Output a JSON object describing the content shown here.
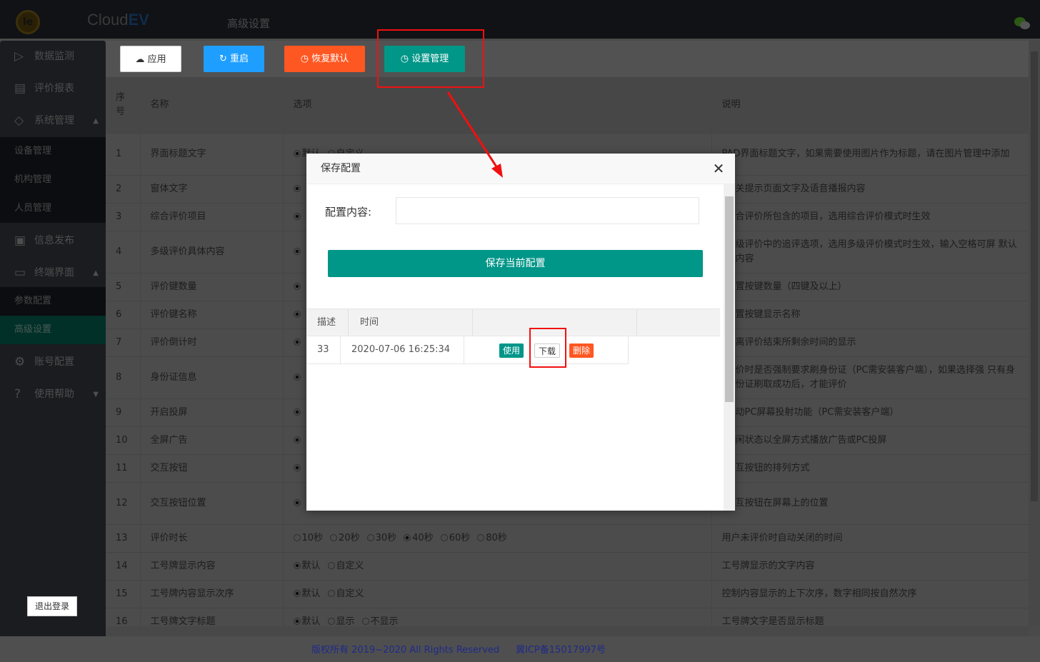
{
  "header": {
    "logo_text": "le",
    "brand_a": "Cloud",
    "brand_b": "EV",
    "page_title": "高级设置"
  },
  "sidebar": {
    "items": [
      {
        "label": "数据监测",
        "icon": "video-icon"
      },
      {
        "label": "评价报表",
        "icon": "clipboard-icon"
      },
      {
        "label": "系统管理",
        "icon": "diamond-icon"
      },
      {
        "label": "信息发布",
        "icon": "image-icon"
      },
      {
        "label": "终端界面",
        "icon": "window-icon"
      },
      {
        "label": "账号配置",
        "icon": "gear-icon"
      },
      {
        "label": "使用帮助",
        "icon": "help-icon"
      }
    ],
    "sub_system": [
      "设备管理",
      "机构管理",
      "人员管理"
    ],
    "sub_terminal": [
      "参数配置",
      "高级设置"
    ],
    "logout": "退出登录"
  },
  "toolbar": {
    "apply": "应用",
    "restart": "重启",
    "restore": "恢复默认",
    "manage": "设置管理"
  },
  "table": {
    "headers": [
      "序号",
      "名称",
      "选项",
      "说明"
    ],
    "rows": [
      {
        "no": "1",
        "name": "界面标题文字",
        "opts": [
          {
            "t": "默认",
            "on": true
          },
          {
            "t": "自定义",
            "on": false
          }
        ],
        "desc": "PAD界面标题文字，如果需要使用图片作为标题，请在图片管理中添加",
        "full": true
      },
      {
        "no": "2",
        "name": "窗体文字",
        "opts": [
          {
            "t": "",
            "on": true
          }
        ],
        "desc": "关提示页面文字及语音播报内容"
      },
      {
        "no": "3",
        "name": "综合评价项目",
        "opts": [
          {
            "t": "",
            "on": true
          }
        ],
        "desc": "合评价所包含的项目，选用综合评价模式时生效"
      },
      {
        "no": "4",
        "name": "多级评价具体内容",
        "opts": [
          {
            "t": "",
            "on": true
          }
        ],
        "desc": "级评价中的追评选项，选用多级评价模式时生效，输入空格可屏 默认内容"
      },
      {
        "no": "5",
        "name": "评价键数量",
        "opts": [
          {
            "t": "",
            "on": true
          }
        ],
        "desc": "置按键数量（四键及以上）"
      },
      {
        "no": "6",
        "name": "评价键名称",
        "opts": [
          {
            "t": "",
            "on": true
          }
        ],
        "desc": "置按键显示名称"
      },
      {
        "no": "7",
        "name": "评价倒计时",
        "opts": [
          {
            "t": "",
            "on": true
          }
        ],
        "desc": "离评价结束所剩余时间的显示"
      },
      {
        "no": "8",
        "name": "身份证信息",
        "opts": [
          {
            "t": "",
            "on": true
          }
        ],
        "desc": "价时是否强制要求刷身份证（PC需安装客户端），如果选择强 只有身份证刷取成功后，才能评价"
      },
      {
        "no": "9",
        "name": "开启投屏",
        "opts": [
          {
            "t": "",
            "on": true
          }
        ],
        "desc": "动PC屏幕投射功能（PC需安装客户端）"
      },
      {
        "no": "10",
        "name": "全屏广告",
        "opts": [
          {
            "t": "",
            "on": true
          }
        ],
        "desc": "闲状态以全屏方式播放广告或PC投屏"
      },
      {
        "no": "11",
        "name": "交互按钮",
        "opts": [
          {
            "t": "",
            "on": true
          }
        ],
        "desc": "互按钮的排列方式"
      },
      {
        "no": "12",
        "name": "交互按钮位置",
        "opts": [
          {
            "t": "",
            "on": true
          }
        ],
        "desc": "互按钮在屏幕上的位置"
      },
      {
        "no": "13",
        "name": "评价时长",
        "opts": [
          {
            "t": "10秒",
            "on": false
          },
          {
            "t": "20秒",
            "on": false
          },
          {
            "t": "30秒",
            "on": false
          },
          {
            "t": "40秒",
            "on": true
          },
          {
            "t": "60秒",
            "on": false
          },
          {
            "t": "80秒",
            "on": false
          }
        ],
        "desc": "用户未评价时自动关闭的时间",
        "full": true
      },
      {
        "no": "14",
        "name": "工号牌显示内容",
        "opts": [
          {
            "t": "默认",
            "on": true
          },
          {
            "t": "自定义",
            "on": false
          }
        ],
        "desc": "工号牌显示的文字内容",
        "full": true
      },
      {
        "no": "15",
        "name": "工号牌内容显示次序",
        "opts": [
          {
            "t": "默认",
            "on": true
          },
          {
            "t": "自定义",
            "on": false
          }
        ],
        "desc": "控制内容显示的上下次序，数字相同按自然次序",
        "full": true
      },
      {
        "no": "16",
        "name": "工号牌文字标题",
        "opts": [
          {
            "t": "默认",
            "on": true
          },
          {
            "t": "显示",
            "on": false
          },
          {
            "t": "不显示",
            "on": false
          }
        ],
        "desc": "工号牌文字是否显示标题",
        "full": true
      }
    ]
  },
  "footer": {
    "copyright": "版权所有 2019~2020 All Rights Reserved",
    "icp": "冀ICP备15017997号"
  },
  "modal": {
    "title": "保存配置",
    "label": "配置内容:",
    "input_value": "",
    "save_button": "保存当前配置",
    "headers": [
      "描述",
      "时间"
    ],
    "rows": [
      {
        "desc": "33",
        "time": "2020-07-06 16:25:34",
        "use": "使用",
        "download": "下载",
        "delete": "删除"
      }
    ]
  },
  "colors": {
    "teal": "#009688",
    "blue": "#1E9FFF",
    "orange": "#FF5722",
    "annotation": "#f01010"
  }
}
